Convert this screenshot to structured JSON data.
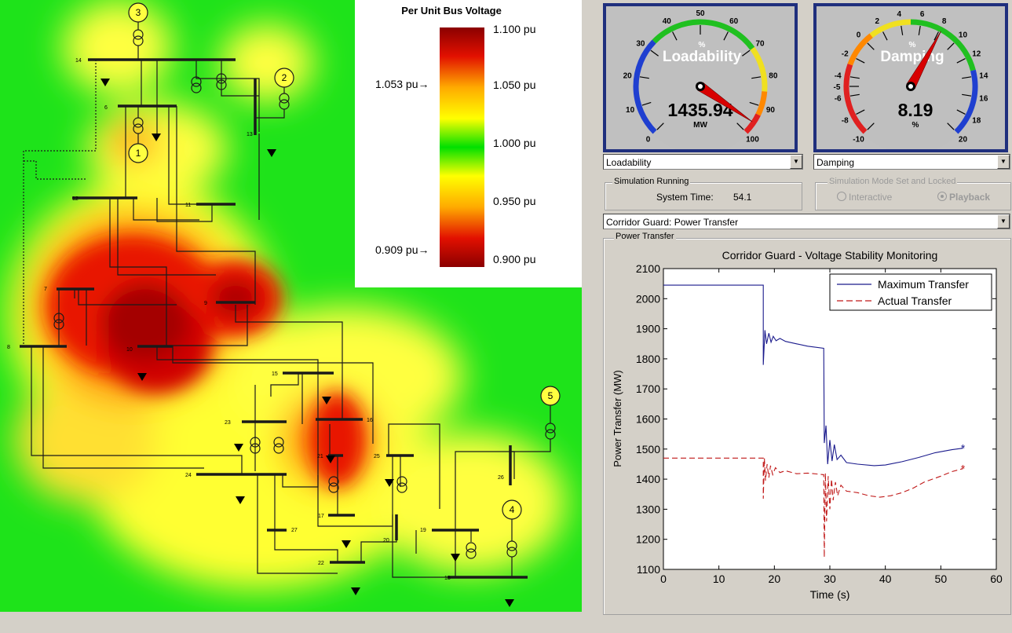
{
  "voltage_map": {
    "legend_title": "Per Unit Bus Voltage",
    "scale_labels": [
      "1.100 pu",
      "1.050 pu",
      "1.000 pu",
      "0.950 pu",
      "0.900 pu"
    ],
    "marker_high": "1.053 pu→",
    "marker_low": "0.909 pu→",
    "colors": {
      "low": "#8b0000",
      "mid_low": "#ff2a00",
      "mid": "#ffff00",
      "ok": "#00e000",
      "high": "#9a0000"
    },
    "generators": [
      "3",
      "2",
      "1",
      "5",
      "4"
    ],
    "bus_labels": [
      "14",
      "6",
      "13",
      "12",
      "11",
      "7",
      "9",
      "8",
      "10",
      "15",
      "16",
      "23",
      "21",
      "25",
      "24",
      "26",
      "17",
      "27",
      "19",
      "20",
      "22",
      "18"
    ]
  },
  "loadability_gauge": {
    "label": "Loadability",
    "unit": "%",
    "ticks": [
      "0",
      "10",
      "20",
      "30",
      "40",
      "50",
      "60",
      "70",
      "80",
      "90",
      "100"
    ],
    "value_text": "1435.94",
    "value_unit": "MW",
    "needle_percent": 96
  },
  "damping_gauge": {
    "label": "Damping",
    "unit": "%",
    "ticks": [
      "-10",
      "-8",
      "-6",
      "-5",
      "-4",
      "-2",
      "0",
      "2",
      "4",
      "6",
      "8",
      "10",
      "12",
      "14",
      "16",
      "18",
      "20"
    ],
    "value_text": "8.19",
    "value_unit": "%",
    "needle_value": 8.19
  },
  "selectors": {
    "left_gauge": "Loadability",
    "right_gauge": "Damping",
    "plot_select": "Corridor Guard: Power Transfer"
  },
  "simulation": {
    "group_title": "Simulation Running",
    "time_label": "System Time:",
    "time_value": "54.1"
  },
  "mode": {
    "group_title": "Simulation Mode Set and Locked",
    "interactive_label": "Interactive",
    "playback_label": "Playback"
  },
  "plot_group_title": "Power Transfer",
  "chart_data": {
    "type": "line",
    "title": "Corridor Guard - Voltage Stability Monitoring",
    "xlabel": "Time (s)",
    "ylabel": "Power Transfer (MW)",
    "xlim": [
      0,
      60
    ],
    "ylim": [
      1100,
      2100
    ],
    "xticks": [
      "0",
      "10",
      "20",
      "30",
      "40",
      "50",
      "60"
    ],
    "yticks": [
      "1100",
      "1200",
      "1300",
      "1400",
      "1500",
      "1600",
      "1700",
      "1800",
      "1900",
      "2000",
      "2100"
    ],
    "grid": false,
    "legend_position": "top-right",
    "series": [
      {
        "name": "Maximum Transfer",
        "color": "#1a1a8c",
        "style": "solid",
        "x": [
          0,
          18,
          18,
          18.3,
          18.6,
          19,
          19.4,
          19.8,
          20.3,
          21,
          22,
          24,
          26,
          28.9,
          29,
          29.3,
          29.6,
          30,
          30.4,
          30.8,
          31.3,
          32,
          33,
          35,
          38,
          40,
          43,
          46,
          49,
          52,
          54
        ],
        "y": [
          2045,
          2045,
          1780,
          1895,
          1850,
          1885,
          1855,
          1875,
          1860,
          1868,
          1858,
          1850,
          1842,
          1835,
          1520,
          1578,
          1450,
          1530,
          1460,
          1515,
          1465,
          1480,
          1455,
          1450,
          1445,
          1447,
          1458,
          1472,
          1488,
          1498,
          1503
        ]
      },
      {
        "name": "Actual Transfer",
        "color": "#c01818",
        "style": "dashed",
        "x": [
          0,
          18,
          18,
          18.2,
          18.4,
          18.7,
          19,
          19.3,
          19.7,
          20.2,
          21,
          22,
          24,
          26,
          28.9,
          29,
          29.2,
          29.4,
          29.7,
          30,
          30.3,
          30.6,
          31,
          31.4,
          32,
          33,
          35,
          37,
          39,
          41,
          43,
          45,
          47,
          50,
          52,
          54
        ],
        "y": [
          1470,
          1470,
          1335,
          1470,
          1395,
          1450,
          1405,
          1445,
          1415,
          1438,
          1422,
          1428,
          1418,
          1420,
          1415,
          1140,
          1420,
          1260,
          1410,
          1300,
          1400,
          1330,
          1390,
          1345,
          1380,
          1360,
          1355,
          1345,
          1340,
          1345,
          1355,
          1370,
          1390,
          1410,
          1425,
          1435
        ]
      }
    ]
  }
}
